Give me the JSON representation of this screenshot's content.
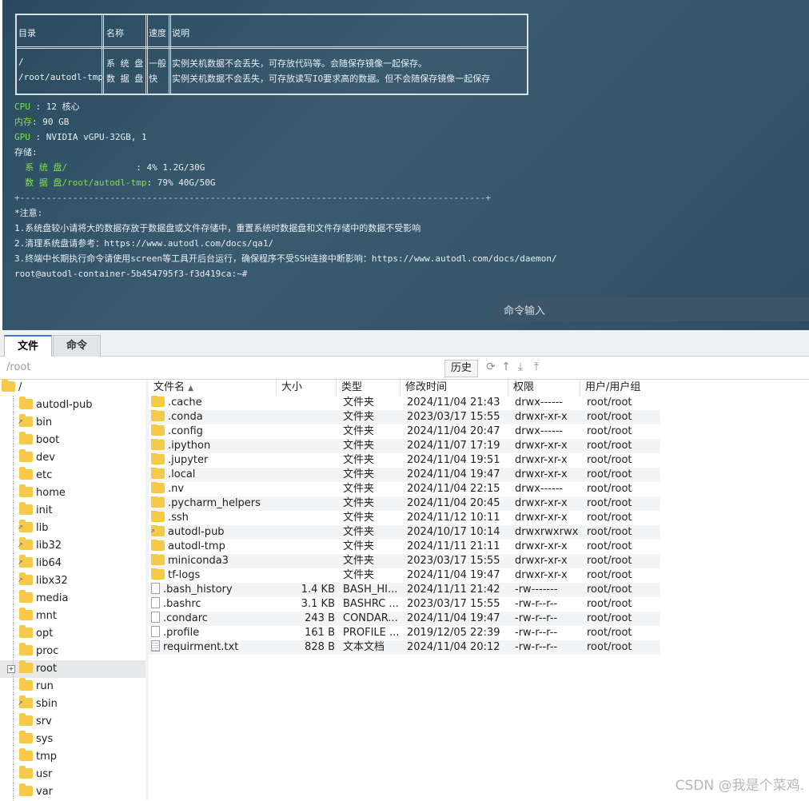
{
  "terminal": {
    "table": {
      "headers": [
        "目录",
        "名称",
        "速度",
        "说明"
      ],
      "rows": [
        [
          "/",
          "系 统 盘",
          "一般",
          "实例关机数据不会丢失，可存放代码等。会随保存镜像一起保存。"
        ],
        [
          "/root/autodl-tmp",
          "数 据 盘",
          " 快 ",
          "实例关机数据不会丢失，可存放读写IO要求高的数据。但不会随保存镜像一起保存"
        ]
      ]
    },
    "cpu_label": "CPU",
    "cpu_value": " : 12 核心",
    "mem_label": "内存",
    "mem_value": ": 90 GB",
    "gpu_label": "GPU",
    "gpu_value": " : NVIDIA vGPU-32GB, 1",
    "storage_label": "存储:",
    "sys_disk_label": "  系 统 盘/",
    "sys_disk_value": "             : 4% 1.2G/30G",
    "data_disk_label": "  数 据 盘/root/autodl-tmp",
    "data_disk_value": ": 79% 40G/50G",
    "separator": "+----------------------------------------------------------------------------------------+",
    "notice_title": "*注意:",
    "notice_1": "1.系统盘较小请将大的数据存放于数据盘或文件存储中，重置系统时数据盘和文件存储中的数据不受影响",
    "notice_2": "2.清理系统盘请参考：https://www.autodl.com/docs/qa1/",
    "notice_3": "3.终端中长期执行命令请使用screen等工具开后台运行，确保程序不受SSH连接中断影响：https://www.autodl.com/docs/daemon/",
    "prompt": "root@autodl-container-5b454795f3-f3d419ca:~#",
    "cmd_placeholder": "命令输入"
  },
  "tabs": {
    "file": "文件",
    "command": "命令"
  },
  "pathbar": {
    "path": "/root",
    "history": "历史"
  },
  "tree": {
    "root": "/",
    "items": [
      "autodl-pub",
      "bin",
      "boot",
      "dev",
      "etc",
      "home",
      "init",
      "lib",
      "lib32",
      "lib64",
      "libx32",
      "media",
      "mnt",
      "opt",
      "proc",
      "root",
      "run",
      "sbin",
      "srv",
      "sys",
      "tmp",
      "usr",
      "var"
    ]
  },
  "list": {
    "headers": {
      "name": "文件名",
      "size": "大小",
      "type": "类型",
      "mtime": "修改时间",
      "perm": "权限",
      "owner": "用户/用户组"
    },
    "rows": [
      {
        "name": ".cache",
        "size": "",
        "type": "文件夹",
        "mtime": "2024/11/04 21:43",
        "perm": "drwx------",
        "owner": "root/root"
      },
      {
        "name": ".conda",
        "size": "",
        "type": "文件夹",
        "mtime": "2023/03/17 15:55",
        "perm": "drwxr-xr-x",
        "owner": "root/root"
      },
      {
        "name": ".config",
        "size": "",
        "type": "文件夹",
        "mtime": "2024/11/04 20:47",
        "perm": "drwx------",
        "owner": "root/root"
      },
      {
        "name": ".ipython",
        "size": "",
        "type": "文件夹",
        "mtime": "2024/11/07 17:19",
        "perm": "drwxr-xr-x",
        "owner": "root/root"
      },
      {
        "name": ".jupyter",
        "size": "",
        "type": "文件夹",
        "mtime": "2024/11/04 19:51",
        "perm": "drwxr-xr-x",
        "owner": "root/root"
      },
      {
        "name": ".local",
        "size": "",
        "type": "文件夹",
        "mtime": "2024/11/04 19:47",
        "perm": "drwxr-xr-x",
        "owner": "root/root"
      },
      {
        "name": ".nv",
        "size": "",
        "type": "文件夹",
        "mtime": "2024/11/04 22:15",
        "perm": "drwx------",
        "owner": "root/root"
      },
      {
        "name": ".pycharm_helpers",
        "size": "",
        "type": "文件夹",
        "mtime": "2024/11/04 20:45",
        "perm": "drwxr-xr-x",
        "owner": "root/root"
      },
      {
        "name": ".ssh",
        "size": "",
        "type": "文件夹",
        "mtime": "2024/11/12 10:11",
        "perm": "drwxr-xr-x",
        "owner": "root/root"
      },
      {
        "name": "autodl-pub",
        "size": "",
        "type": "文件夹",
        "mtime": "2024/10/17 10:14",
        "perm": "drwxrwxrwx",
        "owner": "root/root"
      },
      {
        "name": "autodl-tmp",
        "size": "",
        "type": "文件夹",
        "mtime": "2024/11/11 21:11",
        "perm": "drwxr-xr-x",
        "owner": "root/root"
      },
      {
        "name": "miniconda3",
        "size": "",
        "type": "文件夹",
        "mtime": "2023/03/17 15:55",
        "perm": "drwxr-xr-x",
        "owner": "root/root"
      },
      {
        "name": "tf-logs",
        "size": "",
        "type": "文件夹",
        "mtime": "2024/11/04 19:47",
        "perm": "drwxr-xr-x",
        "owner": "root/root"
      },
      {
        "name": ".bash_history",
        "size": "1.4 KB",
        "type": "BASH_HI...",
        "mtime": "2024/11/11 21:42",
        "perm": "-rw-------",
        "owner": "root/root"
      },
      {
        "name": ".bashrc",
        "size": "3.1 KB",
        "type": "BASHRC ...",
        "mtime": "2023/03/17 15:55",
        "perm": "-rw-r--r--",
        "owner": "root/root"
      },
      {
        "name": ".condarc",
        "size": "243 B",
        "type": "CONDAR...",
        "mtime": "2024/11/04 19:47",
        "perm": "-rw-r--r--",
        "owner": "root/root"
      },
      {
        "name": ".profile",
        "size": "161 B",
        "type": "PROFILE ...",
        "mtime": "2019/12/05 22:39",
        "perm": "-rw-r--r--",
        "owner": "root/root"
      },
      {
        "name": "requirment.txt",
        "size": "828 B",
        "type": "文本文档",
        "mtime": "2024/11/04 20:12",
        "perm": "-rw-r--r--",
        "owner": "root/root"
      }
    ]
  },
  "watermark": "CSDN @我是个菜鸡."
}
